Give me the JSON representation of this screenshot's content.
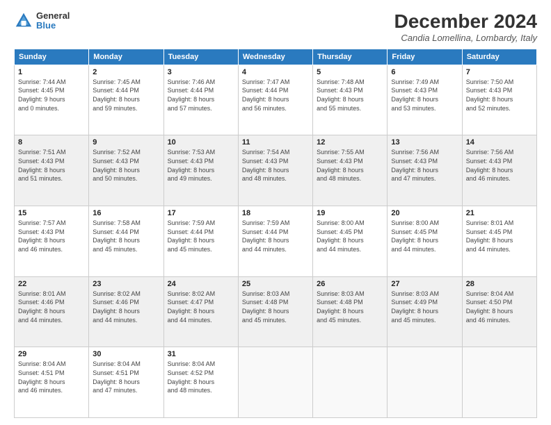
{
  "logo": {
    "general": "General",
    "blue": "Blue"
  },
  "header": {
    "month": "December 2024",
    "location": "Candia Lomellina, Lombardy, Italy"
  },
  "weekdays": [
    "Sunday",
    "Monday",
    "Tuesday",
    "Wednesday",
    "Thursday",
    "Friday",
    "Saturday"
  ],
  "weeks": [
    [
      {
        "day": "1",
        "info": "Sunrise: 7:44 AM\nSunset: 4:45 PM\nDaylight: 9 hours\nand 0 minutes."
      },
      {
        "day": "2",
        "info": "Sunrise: 7:45 AM\nSunset: 4:44 PM\nDaylight: 8 hours\nand 59 minutes."
      },
      {
        "day": "3",
        "info": "Sunrise: 7:46 AM\nSunset: 4:44 PM\nDaylight: 8 hours\nand 57 minutes."
      },
      {
        "day": "4",
        "info": "Sunrise: 7:47 AM\nSunset: 4:44 PM\nDaylight: 8 hours\nand 56 minutes."
      },
      {
        "day": "5",
        "info": "Sunrise: 7:48 AM\nSunset: 4:43 PM\nDaylight: 8 hours\nand 55 minutes."
      },
      {
        "day": "6",
        "info": "Sunrise: 7:49 AM\nSunset: 4:43 PM\nDaylight: 8 hours\nand 53 minutes."
      },
      {
        "day": "7",
        "info": "Sunrise: 7:50 AM\nSunset: 4:43 PM\nDaylight: 8 hours\nand 52 minutes."
      }
    ],
    [
      {
        "day": "8",
        "info": "Sunrise: 7:51 AM\nSunset: 4:43 PM\nDaylight: 8 hours\nand 51 minutes."
      },
      {
        "day": "9",
        "info": "Sunrise: 7:52 AM\nSunset: 4:43 PM\nDaylight: 8 hours\nand 50 minutes."
      },
      {
        "day": "10",
        "info": "Sunrise: 7:53 AM\nSunset: 4:43 PM\nDaylight: 8 hours\nand 49 minutes."
      },
      {
        "day": "11",
        "info": "Sunrise: 7:54 AM\nSunset: 4:43 PM\nDaylight: 8 hours\nand 48 minutes."
      },
      {
        "day": "12",
        "info": "Sunrise: 7:55 AM\nSunset: 4:43 PM\nDaylight: 8 hours\nand 48 minutes."
      },
      {
        "day": "13",
        "info": "Sunrise: 7:56 AM\nSunset: 4:43 PM\nDaylight: 8 hours\nand 47 minutes."
      },
      {
        "day": "14",
        "info": "Sunrise: 7:56 AM\nSunset: 4:43 PM\nDaylight: 8 hours\nand 46 minutes."
      }
    ],
    [
      {
        "day": "15",
        "info": "Sunrise: 7:57 AM\nSunset: 4:43 PM\nDaylight: 8 hours\nand 46 minutes."
      },
      {
        "day": "16",
        "info": "Sunrise: 7:58 AM\nSunset: 4:44 PM\nDaylight: 8 hours\nand 45 minutes."
      },
      {
        "day": "17",
        "info": "Sunrise: 7:59 AM\nSunset: 4:44 PM\nDaylight: 8 hours\nand 45 minutes."
      },
      {
        "day": "18",
        "info": "Sunrise: 7:59 AM\nSunset: 4:44 PM\nDaylight: 8 hours\nand 44 minutes."
      },
      {
        "day": "19",
        "info": "Sunrise: 8:00 AM\nSunset: 4:45 PM\nDaylight: 8 hours\nand 44 minutes."
      },
      {
        "day": "20",
        "info": "Sunrise: 8:00 AM\nSunset: 4:45 PM\nDaylight: 8 hours\nand 44 minutes."
      },
      {
        "day": "21",
        "info": "Sunrise: 8:01 AM\nSunset: 4:45 PM\nDaylight: 8 hours\nand 44 minutes."
      }
    ],
    [
      {
        "day": "22",
        "info": "Sunrise: 8:01 AM\nSunset: 4:46 PM\nDaylight: 8 hours\nand 44 minutes."
      },
      {
        "day": "23",
        "info": "Sunrise: 8:02 AM\nSunset: 4:46 PM\nDaylight: 8 hours\nand 44 minutes."
      },
      {
        "day": "24",
        "info": "Sunrise: 8:02 AM\nSunset: 4:47 PM\nDaylight: 8 hours\nand 44 minutes."
      },
      {
        "day": "25",
        "info": "Sunrise: 8:03 AM\nSunset: 4:48 PM\nDaylight: 8 hours\nand 45 minutes."
      },
      {
        "day": "26",
        "info": "Sunrise: 8:03 AM\nSunset: 4:48 PM\nDaylight: 8 hours\nand 45 minutes."
      },
      {
        "day": "27",
        "info": "Sunrise: 8:03 AM\nSunset: 4:49 PM\nDaylight: 8 hours\nand 45 minutes."
      },
      {
        "day": "28",
        "info": "Sunrise: 8:04 AM\nSunset: 4:50 PM\nDaylight: 8 hours\nand 46 minutes."
      }
    ],
    [
      {
        "day": "29",
        "info": "Sunrise: 8:04 AM\nSunset: 4:51 PM\nDaylight: 8 hours\nand 46 minutes."
      },
      {
        "day": "30",
        "info": "Sunrise: 8:04 AM\nSunset: 4:51 PM\nDaylight: 8 hours\nand 47 minutes."
      },
      {
        "day": "31",
        "info": "Sunrise: 8:04 AM\nSunset: 4:52 PM\nDaylight: 8 hours\nand 48 minutes."
      },
      {
        "day": "",
        "info": ""
      },
      {
        "day": "",
        "info": ""
      },
      {
        "day": "",
        "info": ""
      },
      {
        "day": "",
        "info": ""
      }
    ]
  ]
}
